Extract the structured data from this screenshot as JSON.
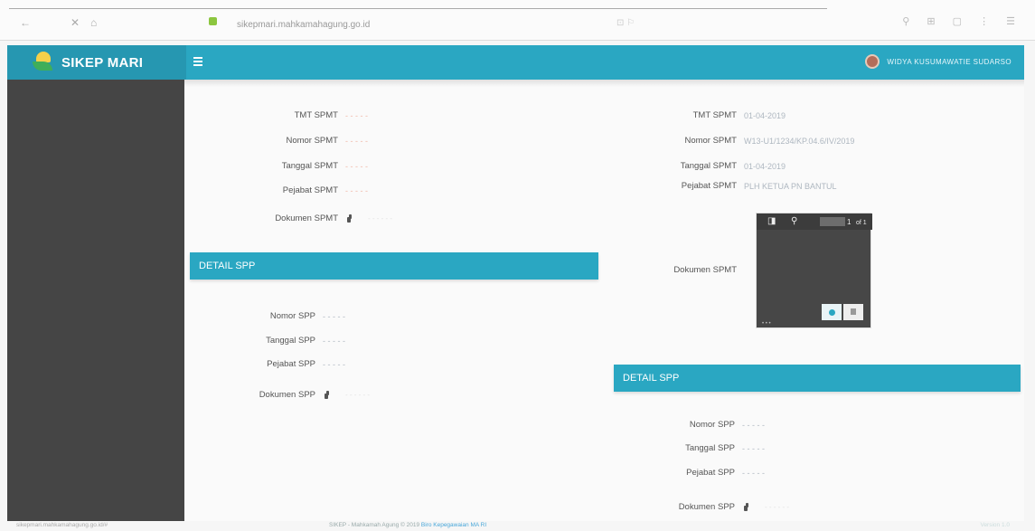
{
  "browser": {
    "url": "sikepmari.mahkamahagung.go.id",
    "back": "←",
    "close": "✕",
    "home": "⌂",
    "toolbar_icons": "⚲ ⊞ ▢ ⋮ ☰",
    "dim_icons": "⊡ ⚐"
  },
  "header": {
    "app_title": "SIKEP MARI",
    "user_name": "WIDYA KUSUMAWATIE SUDARSO"
  },
  "left": {
    "spmt": [
      {
        "label": "TMT SPMT",
        "value": "- - - - -"
      },
      {
        "label": "Nomor SPMT",
        "value": "- - - - -"
      },
      {
        "label": "Tanggal SPMT",
        "value": "- - - - -"
      },
      {
        "label": "Pejabat SPMT",
        "value": "- - - - -"
      }
    ],
    "doc_spmt_label": "Dokumen SPMT",
    "doc_spmt_link": "- - - - - -",
    "section_title": "DETAIL SPP",
    "spp": [
      {
        "label": "Nomor SPP",
        "value": "- - - - -"
      },
      {
        "label": "Tanggal SPP",
        "value": "- - - - -"
      },
      {
        "label": "Pejabat SPP",
        "value": "- - - - -"
      }
    ],
    "doc_spp_label": "Dokumen SPP",
    "doc_spp_link": "- - - - - -"
  },
  "right": {
    "spmt": [
      {
        "label": "TMT SPMT",
        "value": "01-04-2019"
      },
      {
        "label": "Nomor SPMT",
        "value": "W13-U1/1234/KP.04.6/IV/2019"
      },
      {
        "label": "Tanggal SPMT",
        "value": "01-04-2019"
      },
      {
        "label": "Pejabat SPMT",
        "value": "PLH KETUA PN BANTUL"
      }
    ],
    "doc_spmt_label": "Dokumen SPMT",
    "section_title": "DETAIL SPP",
    "spp": [
      {
        "label": "Nomor SPP",
        "value": "- - - - -"
      },
      {
        "label": "Tanggal SPP",
        "value": "- - - - -"
      },
      {
        "label": "Pejabat SPP",
        "value": "- - - - -"
      }
    ],
    "doc_spp_label": "Dokumen SPP",
    "doc_spp_link": "- - - - - -"
  },
  "preview": {
    "sidebar_btn": "◨",
    "search_btn": "⚲",
    "page_text": "1",
    "page_total": "of 1",
    "dots": "• • •"
  },
  "footer": {
    "left": "sikepmari.mahkamahagung.go.id/#",
    "mid": "SIKEP - Mahkamah Agung © 2019",
    "mid_accent": "Biro Kepegawaian MA RI",
    "right": "Version 1.0"
  }
}
